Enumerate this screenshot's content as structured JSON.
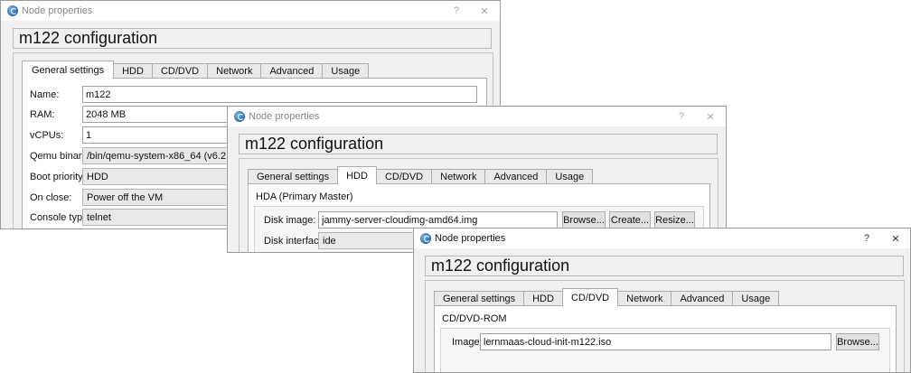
{
  "common": {
    "window_title": "Node properties",
    "help_glyph": "?",
    "close_glyph": "✕",
    "header": "m122 configuration",
    "tabs": [
      "General settings",
      "HDD",
      "CD/DVD",
      "Network",
      "Advanced",
      "Usage"
    ]
  },
  "win_general": {
    "fields": [
      {
        "label": "Name:",
        "value": "m122"
      },
      {
        "label": "RAM:",
        "value": "2048 MB"
      },
      {
        "label": "vCPUs:",
        "value": "1"
      },
      {
        "label": "Qemu binary:",
        "value": "/bin/qemu-system-x86_64 (v6.2.0)"
      },
      {
        "label": "Boot priority:",
        "value": "HDD"
      },
      {
        "label": "On close:",
        "value": "Power off the VM"
      },
      {
        "label": "Console type:",
        "value": "telnet"
      }
    ]
  },
  "win_hdd": {
    "section": "HDA (Primary Master)",
    "disk_image_label": "Disk image:",
    "disk_image_value": "jammy-server-cloudimg-amd64.img",
    "browse": "Browse...",
    "create": "Create...",
    "resize": "Resize...",
    "disk_interface_label": "Disk interface:",
    "disk_interface_value": "ide"
  },
  "win_cddvd": {
    "section": "CD/DVD-ROM",
    "image_label": "Image:",
    "image_value": "lernmaas-cloud-init-m122.iso",
    "browse": "Browse..."
  }
}
